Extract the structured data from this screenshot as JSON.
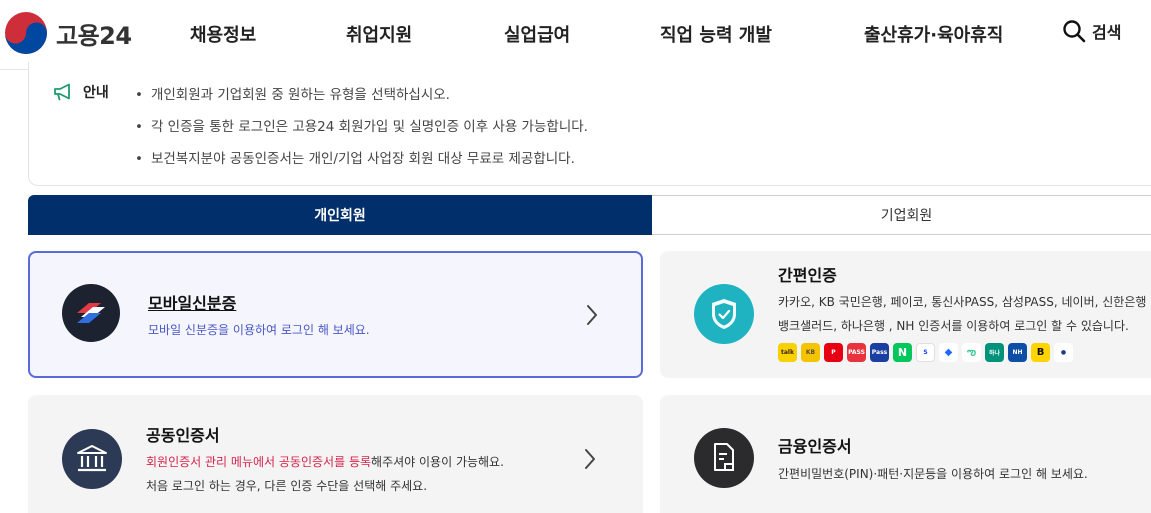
{
  "header": {
    "logo_text": "고용24",
    "nav": [
      "채용정보",
      "취업지원",
      "실업급여",
      "직업 능력 개발",
      "출산휴가·육아휴직"
    ],
    "search_label": "검색"
  },
  "notice": {
    "title": "안내",
    "lines": [
      "개인회원과 기업회원 중 원하는 유형을 선택하십시오.",
      "각 인증을 통한 로그인은 고용24 회원가입 및 실명인증 이후 사용 가능합니다.",
      "보건복지분야 공동인증서는 개인/기업 사업장 회원 대상 무료로 제공합니다."
    ]
  },
  "tabs": {
    "personal": "개인회원",
    "business": "기업회원"
  },
  "cards": {
    "mobile": {
      "title": "모바일신분증",
      "desc": "모바일 신분증을 이용하여 로그인 해 보세요."
    },
    "simple": {
      "title": "간편인증",
      "desc1": "카카오, KB 국민은행, 페이코, 통신사PASS, 삼성PASS, 네이버, 신한은행 ,",
      "desc2": "뱅크샐러드, 하나은행 , NH 인증서를 이용하여 로그인 할 수 있습니다."
    },
    "joint": {
      "title": "공동인증서",
      "desc_red": "회원인증서 관리 메뉴에서 공동인증서를 등록",
      "desc_tail": "해주셔야 이용이 가능해요.",
      "desc2": "처음 로그인 하는 경우, 다른 인증 수단을 선택해 주세요."
    },
    "financial": {
      "title": "금융인증서",
      "desc": "간편비밀번호(PIN)·패턴·지문등을 이용하여 로그인 해 보세요."
    }
  },
  "colors": {
    "primary_navy": "#002f6c",
    "selected_border": "#5b6ad9",
    "teal_icon": "#1fb3c2",
    "dark_icon": "#2c3a55",
    "alert_red": "#d6234a"
  },
  "pay_icons": [
    "kakao",
    "kb",
    "payco",
    "pass",
    "samsung-pass",
    "naver",
    "shinhan",
    "toss",
    "banksalad",
    "hana",
    "nh",
    "b",
    "won"
  ]
}
